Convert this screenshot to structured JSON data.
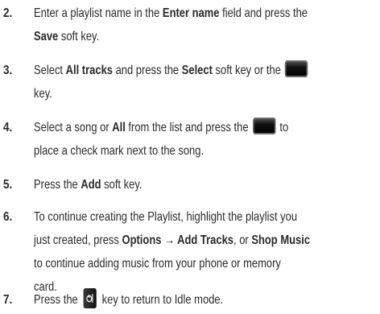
{
  "steps": [
    {
      "number": "2.",
      "lines": [
        [
          "Enter a playlist name in the ",
          "Enter name",
          " field and press the"
        ],
        [
          "",
          "Save",
          " soft key."
        ]
      ]
    },
    {
      "number": "3.",
      "lines": [
        [
          "Select ",
          "All tracks",
          " and press the ",
          "Select",
          " soft key or the"
        ],
        [
          "key."
        ]
      ]
    },
    {
      "number": "4.",
      "lines": [
        [
          "Select a song or ",
          "All",
          " from the list and press the",
          "to"
        ],
        [
          "place a check mark next to the song."
        ]
      ]
    },
    {
      "number": "5.",
      "lines": [
        [
          "Press the ",
          "Add",
          " soft key."
        ]
      ]
    },
    {
      "number": "6.",
      "lines": [
        [
          "To continue creating the Playlist, highlight the playlist you"
        ],
        [
          "just created, press ",
          "Options → Add Tracks",
          ", or ",
          "Shop Music"
        ],
        [
          "to continue adding music from your phone or memory"
        ],
        [
          "card."
        ]
      ]
    },
    {
      "number": "7.",
      "lines": [
        [
          "Press the",
          "key to return to Idle mode."
        ]
      ]
    }
  ],
  "icons": {
    "ok_key": "ok-key-icon",
    "end_key": "end-key-icon"
  }
}
